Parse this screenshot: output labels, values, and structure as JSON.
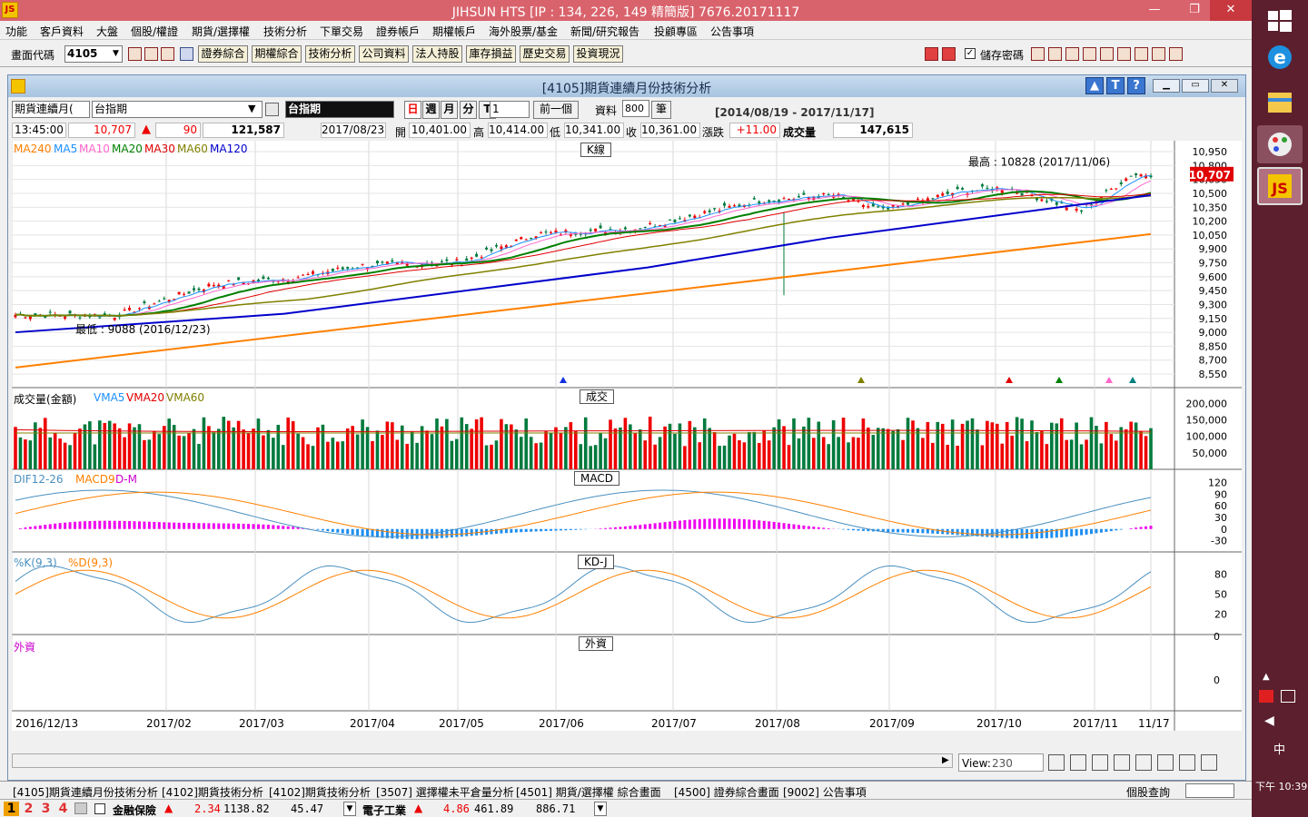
{
  "window": {
    "title": "JIHSUN HTS    [IP : 134, 226, 149 精簡版] 7676.20171117",
    "logo": "JS",
    "min": "—",
    "max": "❐",
    "close": "✕"
  },
  "menu": [
    "功能",
    "客戶資料",
    "大盤",
    "個股/權證",
    "期貨/選擇權",
    "技術分析",
    "下單交易",
    "證券帳戶",
    "期權帳戶",
    "海外股票/基金",
    "新聞/研究報告",
    "投顧專區",
    "公告事項"
  ],
  "toolbar": {
    "code_label": "畫面代碼",
    "code_value": "4105",
    "buttons": [
      "證券綜合",
      "期權綜合",
      "技術分析",
      "公司資料",
      "法人持股",
      "庫存損益",
      "歷史交易",
      "投資現況"
    ],
    "save_pw_label": "儲存密碼",
    "save_pw_checked": true
  },
  "chart_window": {
    "title": "[4105]期貨連續月份技術分析",
    "product_select": "期貨連續月(",
    "product_name": "台指期",
    "product_display": "台指期",
    "periods": [
      "日",
      "週",
      "月",
      "分",
      "T"
    ],
    "period_count": "1",
    "prev_button": "前一個",
    "data_label": "資料",
    "data_count": "800",
    "data_unit": "筆",
    "date_range": "[2014/08/19 - 2017/11/17]"
  },
  "quote": {
    "time": "13:45:00",
    "price": "10,707",
    "change": "90",
    "volume": "121,587",
    "date": "2017/08/23",
    "open_label": "開",
    "open": "10,401.00",
    "high_label": "高",
    "high": "10,414.00",
    "low_label": "低",
    "low": "10,341.00",
    "close_label": "收",
    "close": "10,361.00",
    "chg_label": "漲跌",
    "chg": "+11.00",
    "vol_label": "成交量",
    "vol": "147,615"
  },
  "panels": {
    "k": {
      "title": "K線",
      "legend": [
        {
          "t": "MA240",
          "c": "#ff8000"
        },
        {
          "t": "MA5",
          "c": "#1e90ff"
        },
        {
          "t": "MA10",
          "c": "#ff66cc"
        },
        {
          "t": "MA20",
          "c": "#008000"
        },
        {
          "t": "MA30",
          "c": "#e00000"
        },
        {
          "t": "MA60",
          "c": "#808000"
        },
        {
          "t": "MA120",
          "c": "#0000cc"
        }
      ],
      "high_note": "最高 : 10828 (2017/11/06)",
      "low_note": "最低 : 9088 (2016/12/23)",
      "yticks": [
        "10,950",
        "10,800",
        "10,650",
        "10,500",
        "10,350",
        "10,200",
        "10,050",
        "9,900",
        "9,750",
        "9,600",
        "9,450",
        "9,300",
        "9,150",
        "9,000",
        "8,850",
        "8,700",
        "8,550"
      ],
      "last_price": "10,707"
    },
    "vol": {
      "title": "成交",
      "legend": [
        {
          "t": "成交量(金額)",
          "c": "#000000"
        },
        {
          "t": "VMA5",
          "c": "#1e90ff"
        },
        {
          "t": "VMA20",
          "c": "#e00000"
        },
        {
          "t": "VMA60",
          "c": "#808000"
        }
      ],
      "yticks": [
        "200,000",
        "150,000",
        "100,000",
        "50,000"
      ]
    },
    "macd": {
      "title": "MACD",
      "legend": [
        {
          "t": "DIF12-26",
          "c": "#4a90c0"
        },
        {
          "t": "MACD9",
          "c": "#ff8000"
        },
        {
          "t": "D-M",
          "c": "#cc00cc"
        }
      ],
      "yticks": [
        "120",
        "90",
        "60",
        "30",
        "0",
        "-30"
      ]
    },
    "kd": {
      "title": "KD-J",
      "legend": [
        {
          "t": "%K(9,3)",
          "c": "#4a90c0"
        },
        {
          "t": "%D(9,3)",
          "c": "#ff8000"
        }
      ],
      "yticks": [
        "80",
        "50",
        "20"
      ]
    },
    "foreign": {
      "title": "外資",
      "legend": [
        {
          "t": "外資",
          "c": "#cc00cc"
        }
      ],
      "yticks": [
        "0",
        "0"
      ]
    }
  },
  "xaxis": [
    "2016/12/13",
    "2017/02",
    "2017/03",
    "2017/04",
    "2017/05",
    "2017/06",
    "2017/07",
    "2017/08",
    "2017/09",
    "2017/10",
    "2017/11",
    "11/17"
  ],
  "view": {
    "label": "View:",
    "value": "230"
  },
  "tabs": [
    "[4105]期貨連續月份技術分析",
    "[4102]期貨技術分析",
    "[4102]期貨技術分析",
    "[3507] 選擇權未平倉量分析",
    "[4501] 期貨/選擇權  綜合畫面",
    "[4500] 證券綜合畫面",
    "[9002] 公告事項"
  ],
  "status": {
    "stock_query": "個股查詢"
  },
  "ticker": {
    "pages": [
      "1",
      "2",
      "3",
      "4"
    ],
    "item1_name": "金融保險",
    "item1_chg": "2.34",
    "item1_val": "1138.82",
    "item1_vol": "45.47",
    "item2_name": "電子工業",
    "item2_chg": "4.86",
    "item2_val": "461.89",
    "item2_vol": "886.71"
  },
  "taskbar": {
    "time": "下午 10:39",
    "ime": "中"
  },
  "colors": {
    "up": "#ee0000",
    "down": "#007a3d",
    "title": "#d9636c"
  }
}
